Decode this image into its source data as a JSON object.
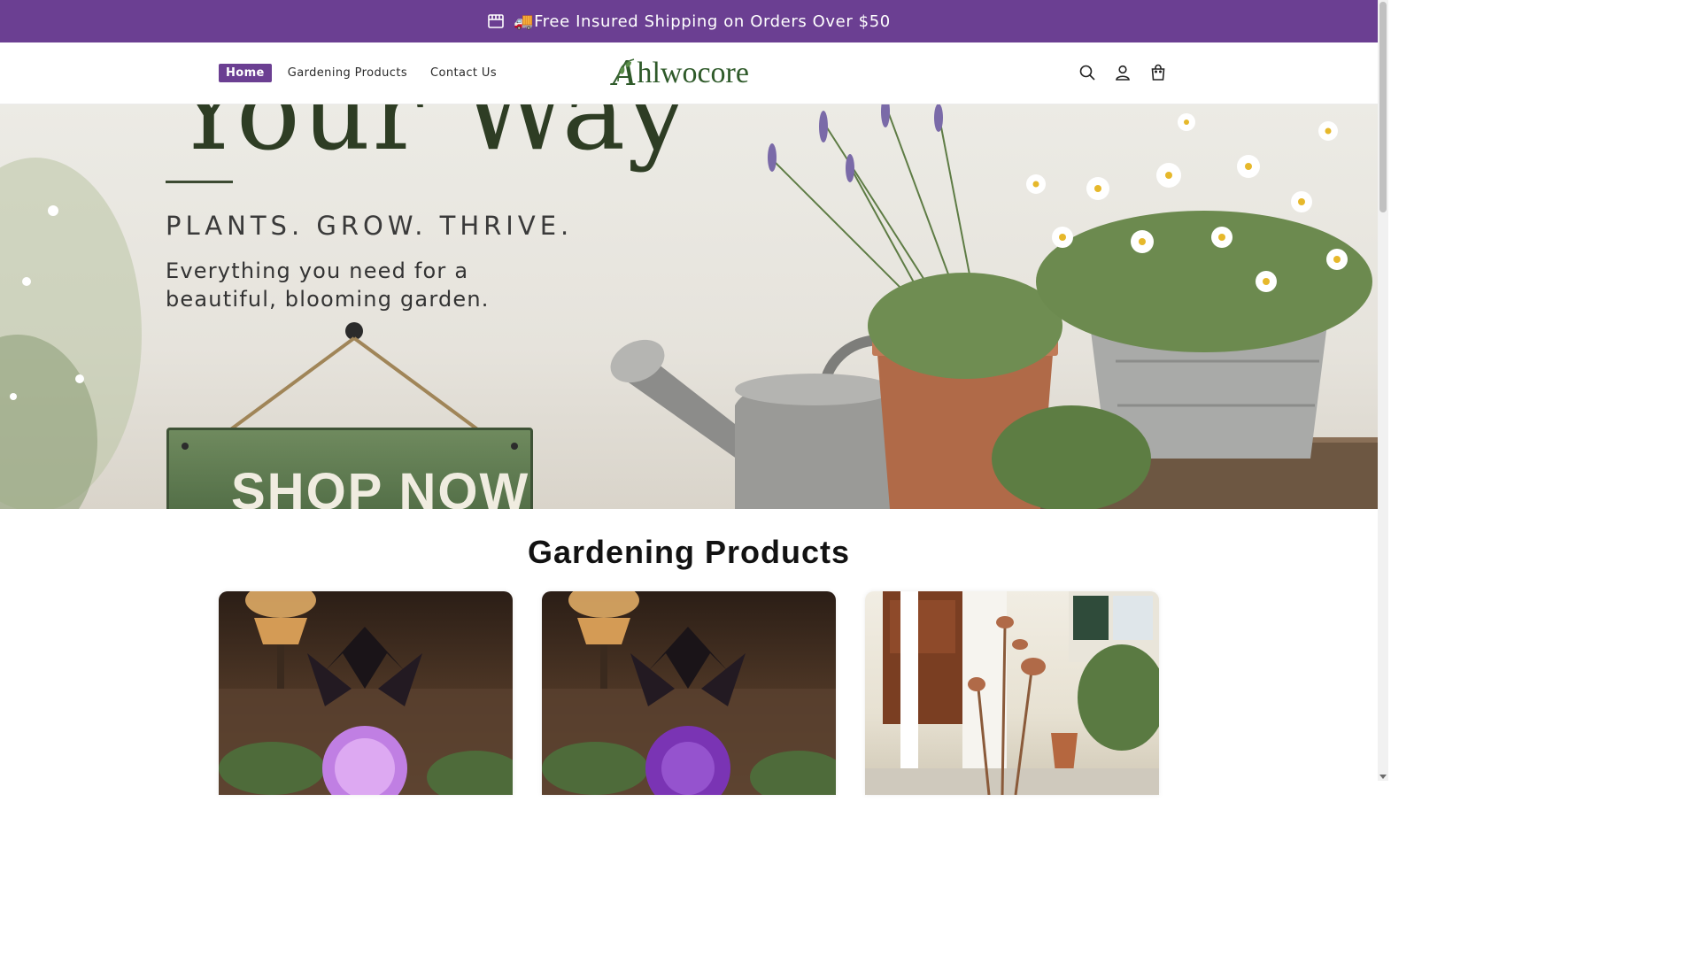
{
  "announcement": {
    "text": "🚚Free Insured Shipping on Orders Over $50",
    "icon": "store-icon"
  },
  "nav": {
    "items": [
      {
        "label": "Home",
        "active": true
      },
      {
        "label": "Gardening Products",
        "active": false
      },
      {
        "label": "Contact Us",
        "active": false
      }
    ]
  },
  "logo": {
    "text_first": "A",
    "text_rest": "hlwocore",
    "alt": "Ahlwocore"
  },
  "header_icons": [
    "search-icon",
    "account-icon",
    "cart-icon"
  ],
  "hero": {
    "big_text": "Your Way",
    "tagline": "PLANTS.  GROW.  THRIVE.",
    "subtitle": "Everything you need for a beautiful, blooming garden.",
    "sign_text": "SHOP NOW"
  },
  "section": {
    "title": "Gardening Products"
  },
  "products": [
    {
      "image": "dragon-orb-lamp"
    },
    {
      "image": "dragon-orb-lamp"
    },
    {
      "image": "copper-flower-stakes"
    }
  ],
  "colors": {
    "brand_purple": "#6b3f92",
    "logo_green": "#2f5a2a"
  }
}
